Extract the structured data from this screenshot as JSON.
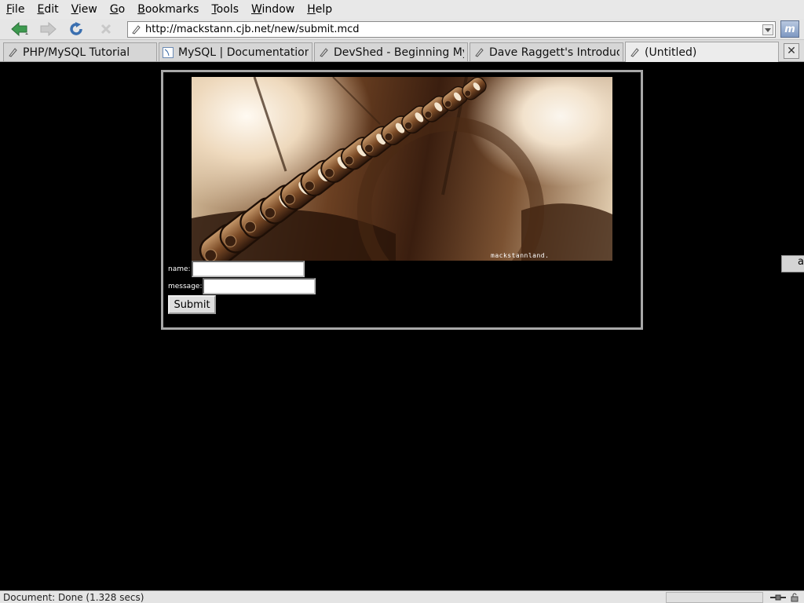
{
  "menubar": {
    "items": [
      "File",
      "Edit",
      "View",
      "Go",
      "Bookmarks",
      "Tools",
      "Window",
      "Help"
    ]
  },
  "toolbar": {
    "back_icon": "back-arrow-icon",
    "forward_icon": "forward-arrow-icon",
    "reload_icon": "reload-icon",
    "stop_icon": "stop-icon",
    "url": "http://mackstann.cjb.net/new/submit.mcd"
  },
  "tabs": [
    {
      "label": "PHP/MySQL Tutorial",
      "active": false
    },
    {
      "label": "MySQL | Documentation ...",
      "active": false
    },
    {
      "label": "DevShed - Beginning My...",
      "active": false
    },
    {
      "label": "Dave Raggett's Introduct...",
      "active": false
    },
    {
      "label": "(Untitled)",
      "active": true
    }
  ],
  "page": {
    "banner_caption": "mackstannland.",
    "form": {
      "name_label": "name:",
      "name_value": "",
      "message_label": "message:",
      "message_value": "",
      "submit_label": "Submit"
    },
    "side_button_label": "a"
  },
  "statusbar": {
    "status_text": "Document: Done (1.328 secs)",
    "progress": 0
  },
  "colors": {
    "page_background": "#000000",
    "frame_border": "#a8a8a8",
    "chrome": "#e6e6e6"
  }
}
